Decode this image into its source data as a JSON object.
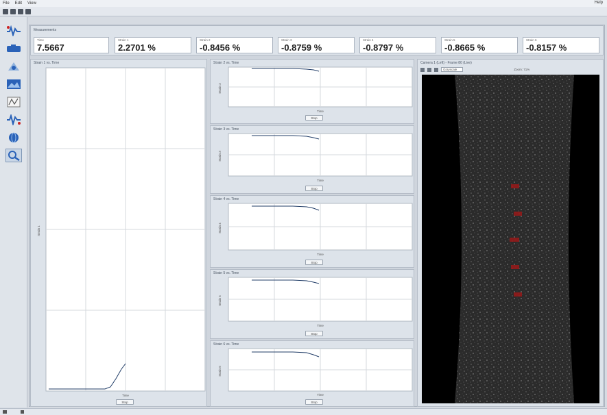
{
  "menu": {
    "items": [
      "File",
      "Edit",
      "View"
    ],
    "help": "Help"
  },
  "measurements": {
    "title": "Measurements",
    "boxes": [
      {
        "label": "Time",
        "value": "7.5667",
        "unit": ""
      },
      {
        "label": "Strain 1",
        "value": "2.2701 %",
        "unit": ""
      },
      {
        "label": "Strain 2",
        "value": "-0.8456 %",
        "unit": ""
      },
      {
        "label": "Strain 3",
        "value": "-0.8759 %",
        "unit": ""
      },
      {
        "label": "Strain 4",
        "value": "-0.8797 %",
        "unit": ""
      },
      {
        "label": "Strain 5",
        "value": "-0.8665 %",
        "unit": ""
      },
      {
        "label": "Strain 6",
        "value": "-0.8157 %",
        "unit": ""
      }
    ]
  },
  "big_chart": {
    "title": "Strain 1 vs. Time",
    "ylabel": "Strain 1",
    "xlabel": "Time",
    "stop": "Stop"
  },
  "small_charts": [
    {
      "title": "Strain 2 vs. Time",
      "ylabel": "Strain 2",
      "xlabel": "Time",
      "stop": "Stop"
    },
    {
      "title": "Strain 3 vs. Time",
      "ylabel": "Strain 3",
      "xlabel": "Time",
      "stop": "Stop"
    },
    {
      "title": "Strain 4 vs. Time",
      "ylabel": "Strain 4",
      "xlabel": "Time",
      "stop": "Stop"
    },
    {
      "title": "Strain 5 vs. Time",
      "ylabel": "Strain 5",
      "xlabel": "Time",
      "stop": "Stop"
    },
    {
      "title": "Strain 6 vs. Time",
      "ylabel": "Strain 6",
      "xlabel": "Time",
      "stop": "Stop"
    }
  ],
  "camera": {
    "title": "Camera 1 (Left) - Frame 80 (Live)",
    "mode": "Grayscale",
    "zoom": "Zoom: 71%"
  },
  "colors": {
    "accent": "#3a5f8f",
    "marker": "#a01818",
    "panel": "#dde3ea"
  }
}
